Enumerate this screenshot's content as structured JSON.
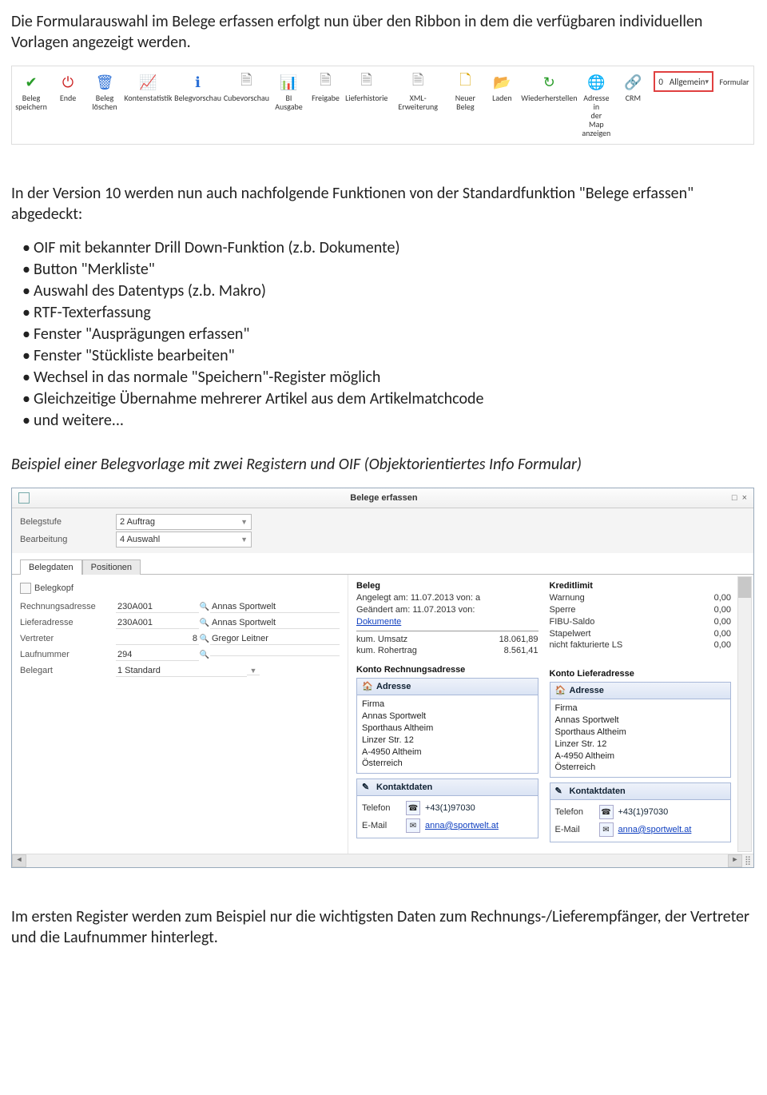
{
  "paras": {
    "p1": "Die Formularauswahl im Belege erfassen erfolgt nun über den Ribbon in dem die verfügbaren individuellen Vorlagen angezeigt werden.",
    "p2": "In der Version 10 werden nun auch nachfolgende Funktionen von der Standardfunktion \"Belege erfassen\" abgedeckt:",
    "p3": "Beispiel einer Belegvorlage mit zwei Registern und OIF (Objektorientiertes Info Formular)",
    "p4": "Im ersten Register werden zum Beispiel nur die wichtigsten Daten zum Rechnungs-/Lieferempfänger, der Vertreter und die Laufnummer hinterlegt."
  },
  "features": [
    "OIF mit bekannter Drill Down-Funktion (z.b. Dokumente)",
    "Button \"Merkliste\"",
    "Auswahl des Datentyps (z.b. Makro)",
    "RTF-Texterfassung",
    "Fenster \"Ausprägungen erfassen\"",
    "Fenster \"Stückliste bearbeiten\"",
    "Wechsel in das normale \"Speichern\"-Register möglich",
    "Gleichzeitige Übernahme mehrerer Artikel aus dem Artikelmatchcode",
    "und weitere..."
  ],
  "ribbon": {
    "items": [
      {
        "label": "Beleg speichern",
        "glyph": "✔",
        "color": "#2a9d2a"
      },
      {
        "label": "Ende",
        "glyph": "⏻",
        "color": "#cc2222"
      },
      {
        "label": "Beleg löschen",
        "glyph": "🗑",
        "color": "#2a6fd6"
      },
      {
        "label": "Kontenstatistik",
        "glyph": "📈",
        "color": "#888"
      },
      {
        "label": "Belegvorschau",
        "glyph": "ℹ",
        "color": "#2a6fd6"
      },
      {
        "label": "Cubevorschau",
        "glyph": "🗎",
        "color": "#888"
      },
      {
        "label": "BI Ausgabe",
        "glyph": "📊",
        "color": "#c55"
      },
      {
        "label": "Freigabe",
        "glyph": "🗎",
        "color": "#888"
      },
      {
        "label": "Lieferhistorie",
        "glyph": "🗎",
        "color": "#888"
      },
      {
        "label": "XML-Erweiterung",
        "glyph": "🗎",
        "color": "#888"
      },
      {
        "label": "Neuer Beleg",
        "glyph": "🗋",
        "color": "#d9a400"
      },
      {
        "label": "Laden",
        "glyph": "📂",
        "color": "#d9a400"
      },
      {
        "label": "Wiederherstellen",
        "glyph": "↻",
        "color": "#2a9d2a"
      },
      {
        "label": "Adresse in der Map anzeigen",
        "glyph": "🌐",
        "color": "#2a6fd6"
      },
      {
        "label": "CRM",
        "glyph": "🔗",
        "color": "#2a6fd6"
      }
    ],
    "formular": {
      "num": "0",
      "label": "Allgemein",
      "btn": "Formular"
    }
  },
  "window": {
    "title": "Belege erfassen",
    "top": {
      "belegstufe": {
        "label": "Belegstufe",
        "value": "2 Auftrag"
      },
      "bearbeitung": {
        "label": "Bearbeitung",
        "value": "4 Auswahl"
      }
    },
    "tabs": {
      "t1": "Belegdaten",
      "t2": "Positionen"
    },
    "group": "Belegkopf",
    "rows": {
      "rechnung": {
        "label": "Rechnungsadresse",
        "value": "230A001",
        "desc": "Annas Sportwelt"
      },
      "liefer": {
        "label": "Lieferadresse",
        "value": "230A001",
        "desc": "Annas Sportwelt"
      },
      "vertreter": {
        "label": "Vertreter",
        "value": "8",
        "desc": "Gregor Leitner"
      },
      "lauf": {
        "label": "Laufnummer",
        "value": "294",
        "desc": ""
      },
      "belegart": {
        "label": "Belegart",
        "value": "1 Standard"
      }
    },
    "beleg": {
      "hdr": "Beleg",
      "l1": "Angelegt am: 11.07.2013  von: a",
      "l2": "Geändert am: 11.07.2013  von:",
      "docs": "Dokumente",
      "kumU": {
        "label": "kum. Umsatz",
        "value": "18.061,89"
      },
      "kumR": {
        "label": "kum. Rohertrag",
        "value": "8.561,41"
      },
      "kontoR": "Konto Rechnungsadresse"
    },
    "kredit": {
      "hdr": "Kreditlimit",
      "rows": [
        {
          "label": "Warnung",
          "value": "0,00"
        },
        {
          "label": "Sperre",
          "value": "0,00"
        },
        {
          "label": "FIBU-Saldo",
          "value": "0,00"
        },
        {
          "label": "Stapelwert",
          "value": "0,00"
        },
        {
          "label": "nicht fakturierte LS",
          "value": "0,00"
        }
      ],
      "kontoL": "Konto Lieferadresse"
    },
    "addr": {
      "hdr": "Adresse",
      "lines": [
        "Firma",
        "Annas Sportwelt",
        "Sporthaus Altheim",
        "Linzer Str. 12",
        "A-4950 Altheim",
        "Österreich"
      ]
    },
    "kontakt": {
      "hdr": "Kontaktdaten",
      "tel": {
        "label": "Telefon",
        "value": "+43(1)97030"
      },
      "mail": {
        "label": "E-Mail",
        "value": "anna@sportwelt.at"
      }
    }
  }
}
